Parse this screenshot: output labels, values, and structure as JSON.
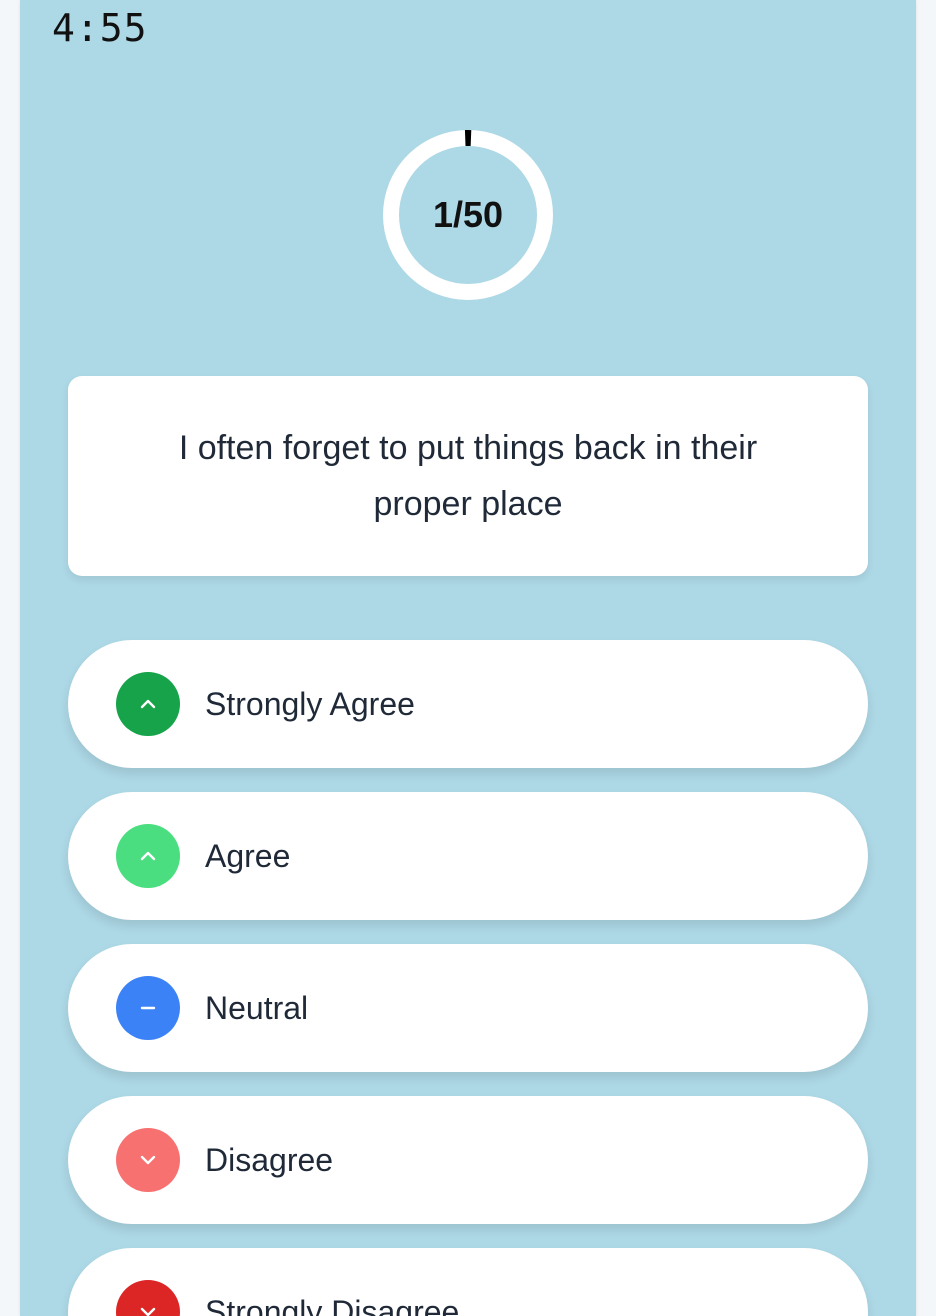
{
  "timer": {
    "text": "4:55"
  },
  "progress": {
    "label": "1/50",
    "current": 1,
    "total": 50
  },
  "question": {
    "text": "I often forget to put things back in their proper place"
  },
  "options": [
    {
      "label": "Strongly Agree",
      "icon": "chevron-up-icon",
      "color": "#16a34a"
    },
    {
      "label": "Agree",
      "icon": "chevron-up-icon",
      "color": "#4ade80"
    },
    {
      "label": "Neutral",
      "icon": "minus-icon",
      "color": "#3b82f6"
    },
    {
      "label": "Disagree",
      "icon": "chevron-down-icon",
      "color": "#f87171"
    },
    {
      "label": "Strongly Disagree",
      "icon": "chevron-down-icon",
      "color": "#dc2626"
    }
  ],
  "colors": {
    "background": "#add8e6",
    "card": "#ffffff",
    "ring_track": "#ffffff",
    "ring_progress": "#000000"
  }
}
